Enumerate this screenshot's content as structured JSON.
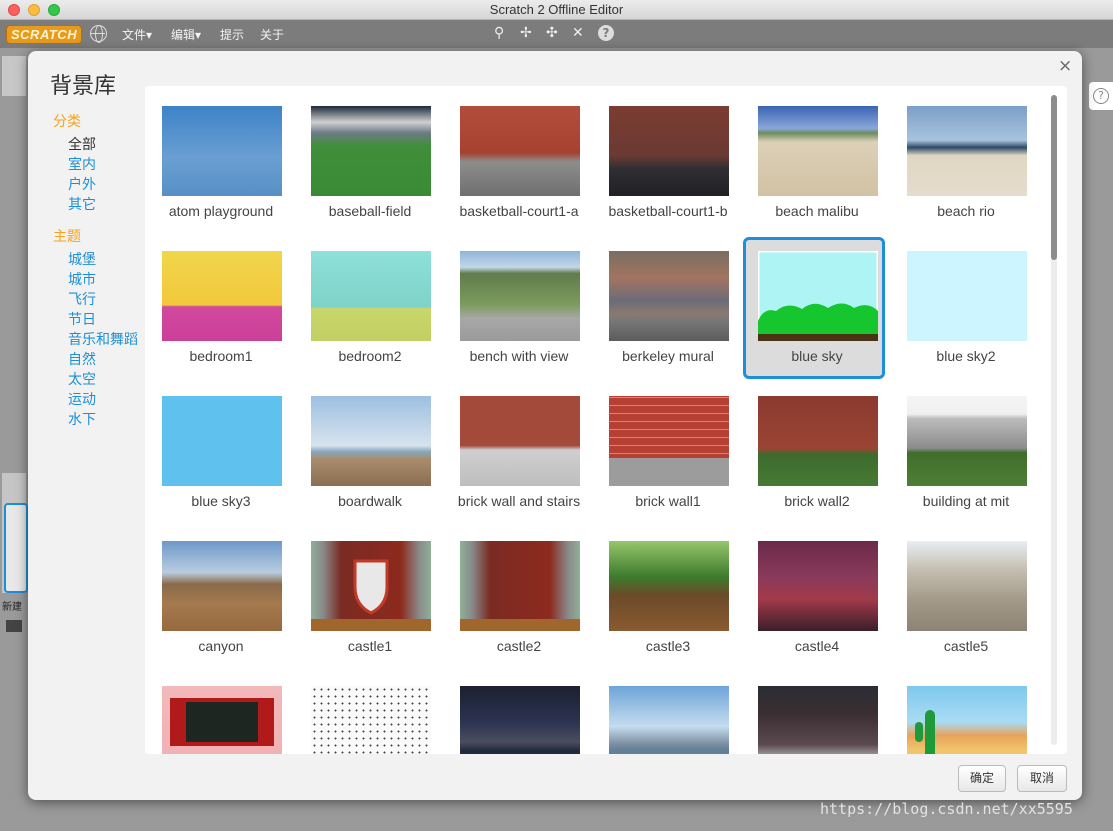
{
  "window": {
    "title": "Scratch 2 Offline Editor"
  },
  "menubar": {
    "logo": "SCRATCH",
    "items": [
      "文件▾",
      "编辑▾",
      "提示",
      "关于"
    ]
  },
  "dialog": {
    "title": "背景库",
    "close_glyph": "×",
    "section_category": "分类",
    "categories": [
      "全部",
      "室内",
      "户外",
      "其它"
    ],
    "selected_category": "全部",
    "section_theme": "主题",
    "themes": [
      "城堡",
      "城市",
      "飞行",
      "节日",
      "音乐和舞蹈",
      "自然",
      "太空",
      "运动",
      "水下"
    ],
    "ok_label": "确定",
    "cancel_label": "取消",
    "selected_item": "blue sky",
    "items": [
      "atom playground",
      "baseball-field",
      "basketball-court1-a",
      "basketball-court1-b",
      "beach malibu",
      "beach rio",
      "bedroom1",
      "bedroom2",
      "bench with view",
      "berkeley mural",
      "blue sky",
      "blue sky2",
      "blue sky3",
      "boardwalk",
      "brick wall and stairs",
      "brick wall1",
      "brick wall2",
      "building at mit",
      "canyon",
      "castle1",
      "castle2",
      "castle3",
      "castle4",
      "castle5"
    ]
  },
  "left_panel": {
    "new_label": "新建"
  },
  "watermark": "https://blog.csdn.net/xx5595",
  "colors": {
    "accent": "#1d8fd6",
    "section": "#f7a21c",
    "selected_border": "#1d8fd6"
  }
}
